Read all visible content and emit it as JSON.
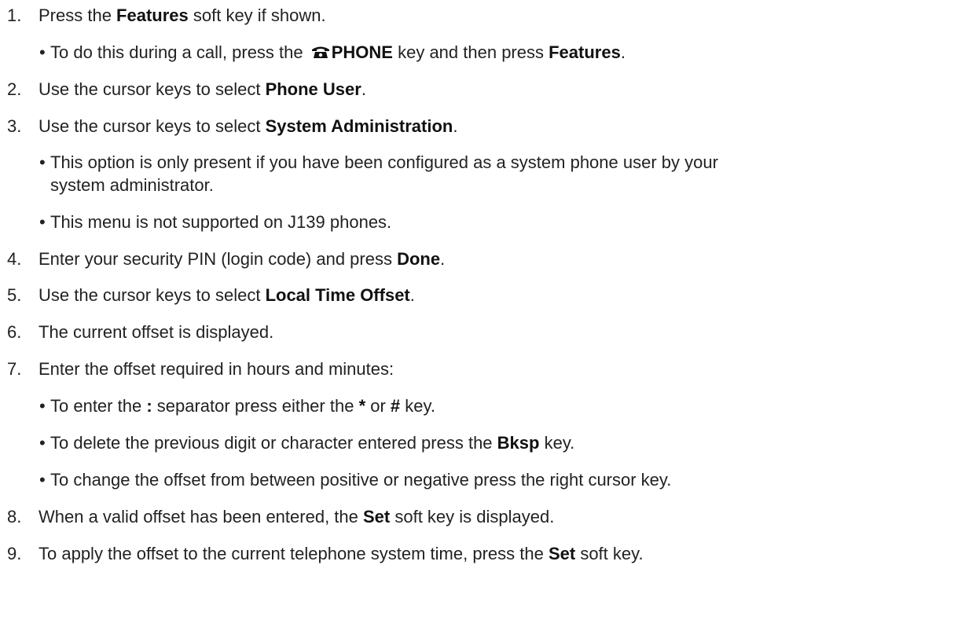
{
  "steps": [
    {
      "num": "1.",
      "pre": "Press the ",
      "b": "Features",
      "post": " soft key if shown."
    },
    {
      "num": "2.",
      "pre": "Use the cursor keys to select ",
      "b": "Phone User",
      "post": "."
    },
    {
      "num": "3.",
      "pre": "Use the cursor keys to select ",
      "b": "System Administration",
      "post": "."
    },
    {
      "num": "4.",
      "pre": "Enter your security PIN (login code) and press ",
      "b": "Done",
      "post": "."
    },
    {
      "num": "5.",
      "pre": "Use the cursor keys to select ",
      "b": "Local Time Offset",
      "post": "."
    },
    {
      "num": "6.",
      "text": "The current offset is displayed."
    },
    {
      "num": "7.",
      "text": "Enter the offset required in hours and minutes:"
    },
    {
      "num": "8.",
      "pre": "When a valid offset has been entered, the ",
      "b": "Set",
      "post": " soft key is displayed."
    },
    {
      "num": "9.",
      "pre": "To apply the offset to the current telephone system time, press the ",
      "b": "Set",
      "post": " soft key."
    }
  ],
  "bullets": {
    "s1": {
      "pre": "To do this during a call, press the ",
      "icon": "phone-icon",
      "b1": "PHONE",
      "mid": " key and then press ",
      "b2": "Features",
      "post": "."
    },
    "s3a_line1": "This option is only present if you have been configured as a system phone user by your",
    "s3a_line2": "system administrator.",
    "s3b": "This menu is not supported on J139 phones.",
    "s7a": {
      "pre": "To enter the ",
      "b1": ":",
      "mid1": " separator press either the ",
      "b2": "*",
      "mid2": " or ",
      "b3": "#",
      "post": " key."
    },
    "s7b": {
      "pre": "To delete the previous digit or character entered press the ",
      "b": "Bksp",
      "post": " key."
    },
    "s7c": "To change the offset from between positive or negative press the right cursor key."
  },
  "bullet_char": "•"
}
